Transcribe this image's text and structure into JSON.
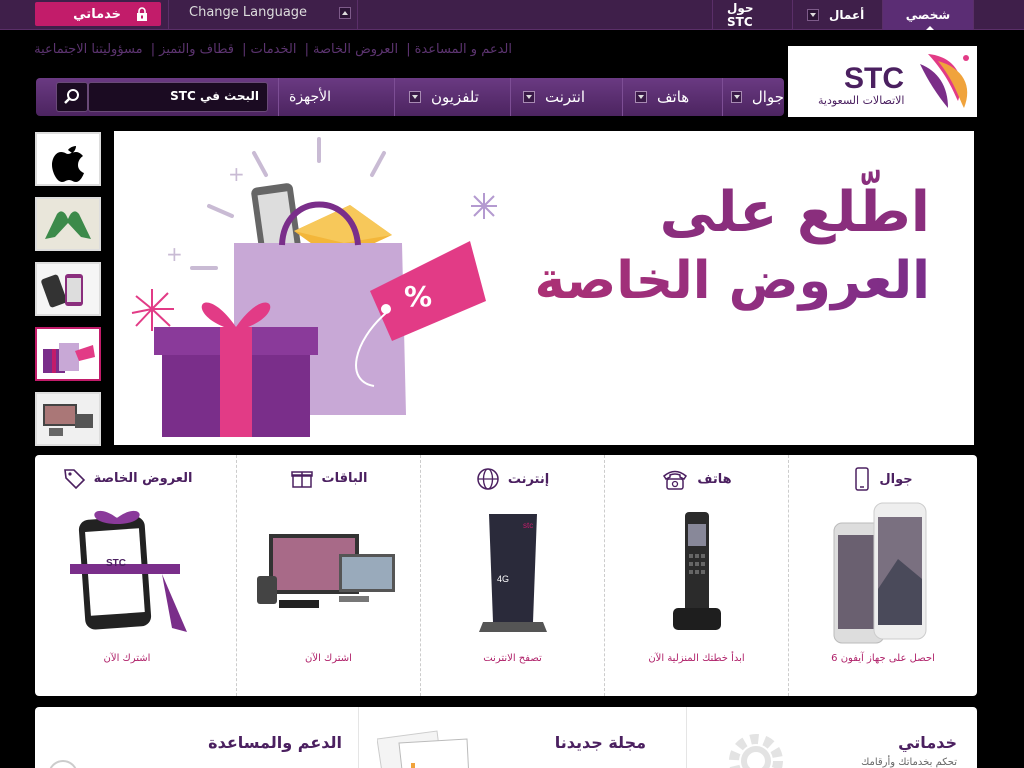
{
  "topbar": {
    "my_services": "خدماتي",
    "change_language": "Change Language",
    "about_stc": "حول STC",
    "business": "أعمال",
    "personal": "شخصي"
  },
  "links": [
    "الدعم و المساعدة",
    "العروض الخاصة",
    "الخدمات",
    "قطاف والتميز",
    "مسؤوليتنا الاجتماعية"
  ],
  "logo": {
    "brand": "STC",
    "tagline": "الاتصالات السعودية"
  },
  "nav": {
    "mobile": "جوال",
    "phone": "هاتف",
    "internet": "انترنت",
    "tv": "تلفزيون",
    "devices": "الأجهزة",
    "search_placeholder": "البحث في STC"
  },
  "banner": {
    "line1": "اطّلع على",
    "line2": "العروض الخاصة",
    "badge": "%"
  },
  "products": [
    {
      "title": "جوال",
      "link": "احصل على جهاز آيفون 6",
      "icon": "mobile-icon"
    },
    {
      "title": "هاتف",
      "link": "ابدأ خطتك المنزلية الآن",
      "icon": "phone-icon"
    },
    {
      "title": "إنترنت",
      "link": "تصفح الانترنت",
      "icon": "globe-icon"
    },
    {
      "title": "الباقات",
      "link": "اشترك الآن",
      "icon": "gift-icon"
    },
    {
      "title": "العروض الخاصة",
      "link": "اشترك الآن",
      "icon": "tag-icon"
    }
  ],
  "bottom": {
    "services_title": "خدماتي",
    "services_sub": "تحكم بخدماتك وأرقامك",
    "magazine_title": "مجلة جديدنا",
    "support_title": "الدعم والمساعدة"
  },
  "colors": {
    "accent": "#c21c6a",
    "purple": "#5b2d74",
    "nav": "#6a3a82"
  }
}
